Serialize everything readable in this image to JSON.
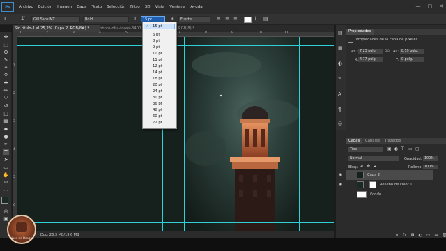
{
  "menu": [
    "Archivo",
    "Edición",
    "Imagen",
    "Capa",
    "Texto",
    "Selección",
    "Filtro",
    "3D",
    "Vista",
    "Ventana",
    "Ayuda"
  ],
  "options": {
    "font_family": "Gill Sans MT",
    "font_style": "Bold",
    "font_size": "15 pt",
    "antialias": "Fuerte"
  },
  "tabs": [
    {
      "label": "Sin título-1 al 25,2% (Capa 2, RGB/8#) *",
      "active": true
    },
    {
      "label": "photo-of-a-tower-3400…",
      "active": false
    },
    {
      "label": "RGB/8) *",
      "active": false
    }
  ],
  "ruler": {
    "h": [
      "1",
      "2",
      "3",
      "4",
      "5",
      "6",
      "7",
      "8",
      "9",
      "10",
      "11"
    ],
    "v": [
      "1",
      "2",
      "3",
      "4",
      "5",
      "6"
    ]
  },
  "font_size_dropdown": {
    "selected": "15 pt",
    "options": [
      "6 pt",
      "8 pt",
      "9 pt",
      "10 pt",
      "11 pt",
      "12 pt",
      "14 pt",
      "18 pt",
      "20 pt",
      "24 pt",
      "30 pt",
      "36 pt",
      "48 pt",
      "60 pt",
      "72 pt"
    ]
  },
  "status": {
    "doc": "Doc: 26,3 MB/19,6 MB"
  },
  "properties": {
    "tab": "Propiedades",
    "subtitle": "Propiedades de la capa de píxeles",
    "width_label": "An.:",
    "width": "7,23 pulg.",
    "link": "GO",
    "height_label": "Al.:",
    "height": "8,59 pulg.",
    "x_label": "X:",
    "x": "4,77 pulg.",
    "y_label": "Y:",
    "y": "0 pulg."
  },
  "layers": {
    "tabs": [
      "Capas",
      "Canales",
      "Trazados"
    ],
    "kind": "Tipo",
    "blend_mode": "Normal",
    "opacity_label": "Opacidad:",
    "opacity": "100%",
    "lock_label": "Bloq.:",
    "fill_label": "Relleno:",
    "fill": "100%",
    "items": [
      {
        "name": "Capa 2",
        "selected": true
      },
      {
        "name": "Relleno de color 1",
        "selected": false
      },
      {
        "name": "Fondo",
        "selected": false
      }
    ]
  },
  "watermark": {
    "text": "Disco de Dragón"
  },
  "colors": {
    "guide": "#2fd0d8",
    "selection": "#1f5fb0",
    "accent": "#3d8fd1"
  }
}
